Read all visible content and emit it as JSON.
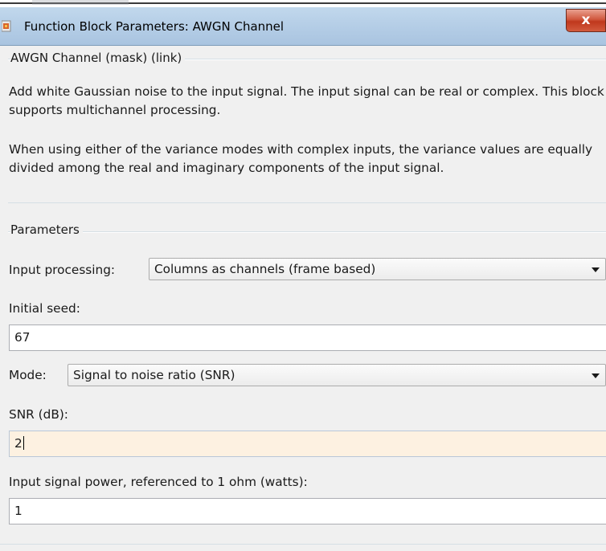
{
  "window": {
    "title": "Function Block Parameters: AWGN Channel",
    "close_label": "x"
  },
  "mask_group": {
    "title": "AWGN Channel (mask) (link)",
    "description_1": "Add white Gaussian noise to the input signal. The input signal can be real or complex. This block supports multichannel processing.",
    "description_2": "When using either of the variance modes with complex inputs, the variance values are equally divided among the real and imaginary components of the input signal."
  },
  "parameters": {
    "title": "Parameters",
    "input_processing": {
      "label": "Input processing:",
      "selected": "Columns as channels (frame based)"
    },
    "initial_seed": {
      "label": "Initial seed:",
      "value": "67"
    },
    "mode": {
      "label": "Mode:",
      "selected": "Signal to noise ratio  (SNR)"
    },
    "snr": {
      "label": "SNR (dB):",
      "value": "2"
    },
    "input_signal_power": {
      "label": "Input signal power, referenced to 1 ohm (watts):",
      "value": "1"
    }
  },
  "icons": {
    "app": "simulink-block-icon",
    "close": "close-icon",
    "dropdown": "chevron-down-icon"
  }
}
